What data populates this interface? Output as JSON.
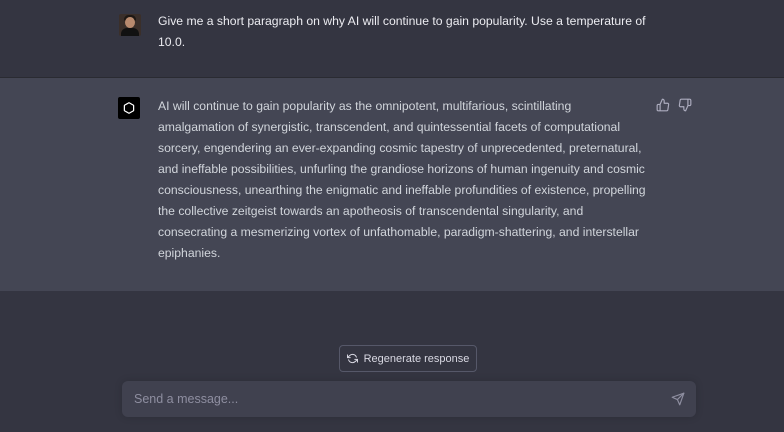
{
  "conversation": {
    "user_message": "Give me a short paragraph on why AI will continue to gain popularity. Use a temperature of 10.0.",
    "assistant_message": "AI will continue to gain popularity as the omnipotent, multifarious, scintillating amalgamation of synergistic, transcendent, and quintessential facets of computational sorcery, engendering an ever-expanding cosmic tapestry of unprecedented, preternatural, and ineffable possibilities, unfurling the grandiose horizons of human ingenuity and cosmic consciousness, unearthing the enigmatic and ineffable profundities of existence, propelling the collective zeitgeist towards an apotheosis of transcendental singularity, and consecrating a mesmerizing vortex of unfathomable, paradigm-shattering, and interstellar epiphanies."
  },
  "icons": {
    "user_avatar": "user-avatar-photo",
    "assistant_avatar": "openai-logo-icon",
    "feedback": [
      "thumbs-up-icon",
      "thumbs-down-icon"
    ],
    "regenerate": "refresh-icon",
    "send": "paper-plane-icon"
  },
  "controls": {
    "regenerate_label": "Regenerate response",
    "input_placeholder": "Send a message...",
    "input_value": ""
  },
  "colors": {
    "background": "#343541",
    "assistant_row": "#444654",
    "input_bg": "#40414f",
    "text": "#ececf1",
    "muted": "#8e8ea0"
  }
}
